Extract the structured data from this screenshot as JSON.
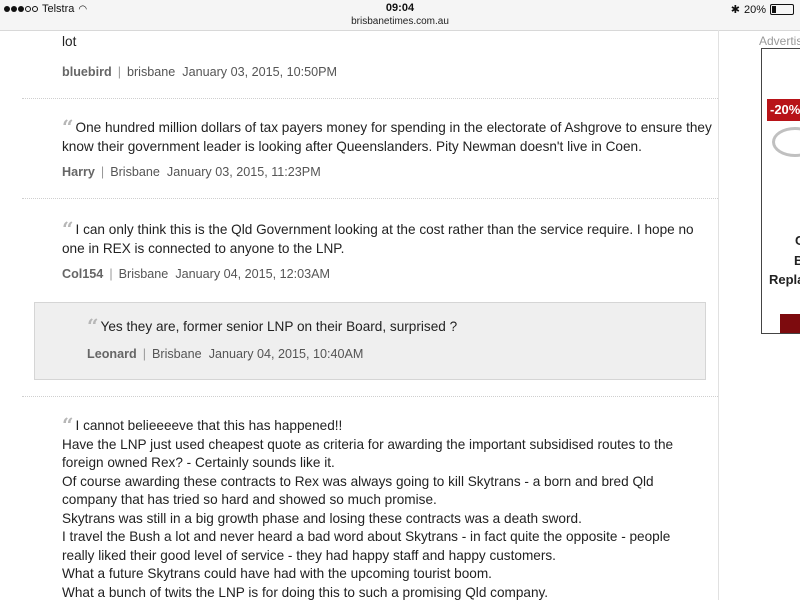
{
  "status_bar": {
    "carrier": "Telstra",
    "time": "09:04",
    "url": "brisbanetimes.com.au",
    "battery": "20%"
  },
  "comments": [
    {
      "text": "lot",
      "author": "bluebird",
      "location": "brisbane",
      "date": "January 03, 2015, 10:50PM"
    },
    {
      "text": "One hundred million dollars of tax payers money for spending in the electorate of Ashgrove to ensure they know their government leader is looking after Queenslanders. Pity Newman doesn't live in Coen.",
      "author": "Harry",
      "location": "Brisbane",
      "date": "January 03, 2015, 11:23PM"
    },
    {
      "text": "I can only think this is the Qld Government looking at the cost rather than the service require. I hope no one in REX is connected to anyone to the LNP.",
      "author": "Col154",
      "location": "Brisbane",
      "date": "January 04, 2015, 12:03AM"
    },
    {
      "text": "Yes they are, former senior LNP on their Board, surprised ?",
      "author": "Leonard",
      "location": "Brisbane",
      "date": "January 04, 2015, 10:40AM"
    },
    {
      "lines": [
        "I cannot belieeeeve that this has happened!!",
        "Have the LNP just used cheapest quote as criteria for awarding the important subsidised routes to the",
        "foreign owned Rex? - Certainly sounds like it.",
        "Of course awarding these contracts to Rex was always going to kill Skytrans - a born and bred Qld",
        "company that has tried so hard and showed so much promise.",
        "Skytrans was still in a big growth phase and losing these contracts was a death sword.",
        "I travel the Bush a lot and never heard a bad word about Skytrans - in fact quite the opposite - people",
        "really liked their good level of service - they had happy staff and happy customers.",
        "What a future Skytrans could have had with the upcoming tourist boom.",
        "What a bunch of twits the LNP is for doing this to such a promising Qld company."
      ]
    }
  ],
  "quote_glyph": "“",
  "separator": "|",
  "sidebar": {
    "ad_label": "Advertisement",
    "badge": "-20%",
    "line1": "C",
    "line2": "B",
    "line3": "Repla",
    "price": "$"
  }
}
